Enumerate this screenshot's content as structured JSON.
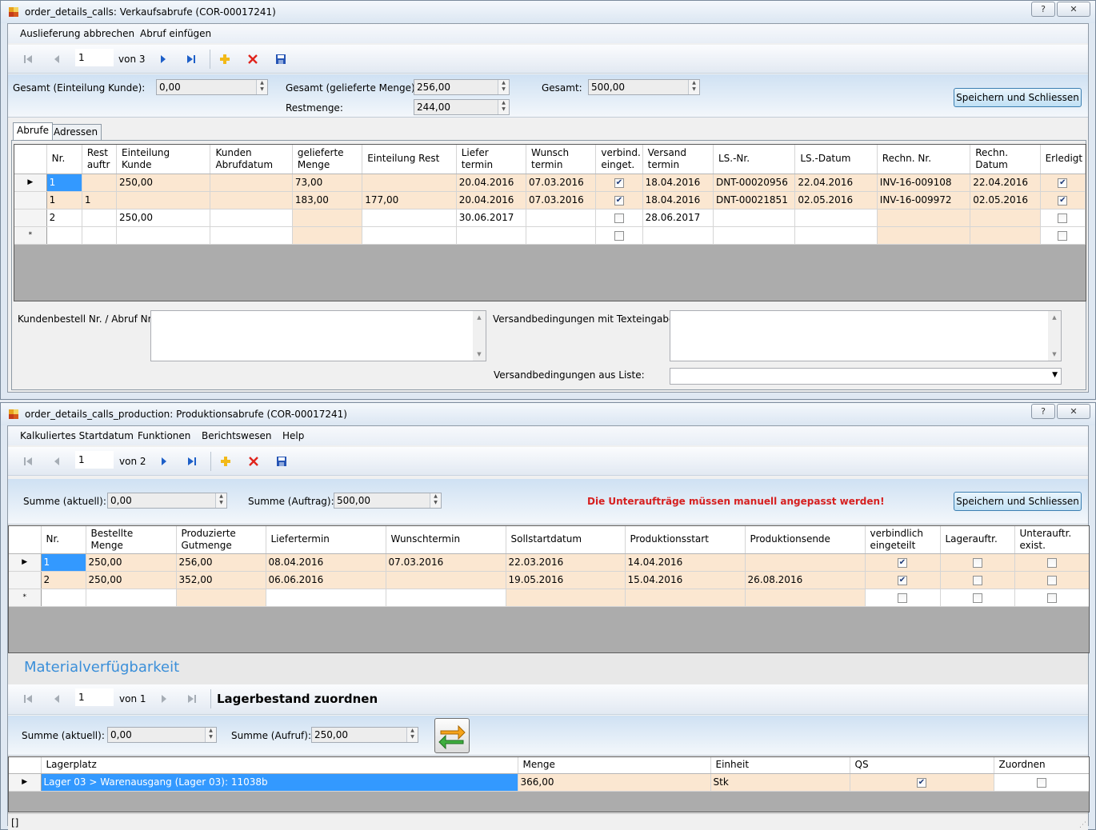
{
  "window1": {
    "title": "order_details_calls: Verkaufsabrufe (COR-00017241)",
    "help": "?",
    "close": "✕",
    "menu": [
      "Auslieferung abbrechen",
      "Abruf einfügen"
    ],
    "nav": {
      "position": "1",
      "of_label": "von 3"
    },
    "sums": {
      "gesamt_einteilung_label": "Gesamt (Einteilung Kunde):",
      "gesamt_einteilung_value": "0,00",
      "gesamt_geliefert_label": "Gesamt (gelieferte Menge):",
      "gesamt_geliefert_value": "256,00",
      "restmenge_label": "Restmenge:",
      "restmenge_value": "244,00",
      "gesamt_label": "Gesamt:",
      "gesamt_value": "500,00",
      "save_close": "Speichern und Schliessen"
    },
    "tabs": [
      "Abrufe",
      "Adressen"
    ],
    "grid_headers": [
      "Nr.",
      "Rest\nauftr",
      "Einteilung\nKunde",
      "Kunden\nAbrufdatum",
      "gelieferte\nMenge",
      "Einteilung Rest",
      "Liefer\ntermin",
      "Wunsch\ntermin",
      "verbind.\neinget.",
      "Versand\ntermin",
      "LS.-Nr.",
      "LS.-Datum",
      "Rechn. Nr.",
      "Rechn.\nDatum",
      "Erledigt"
    ],
    "grid_rows": [
      {
        "marker": "▶",
        "cells": [
          "1",
          "",
          "250,00",
          "",
          "73,00",
          "",
          "20.04.2016",
          "07.03.2016",
          true,
          "18.04.2016",
          "DNT-00020956",
          "22.04.2016",
          "INV-16-009108",
          "22.04.2016",
          true
        ]
      },
      {
        "marker": "",
        "cells": [
          "1",
          "1",
          "",
          "",
          "183,00",
          "177,00",
          "20.04.2016",
          "07.03.2016",
          true,
          "18.04.2016",
          "DNT-00021851",
          "02.05.2016",
          "INV-16-009972",
          "02.05.2016",
          true
        ]
      },
      {
        "marker": "",
        "cells": [
          "2",
          "",
          "250,00",
          "",
          "",
          "",
          "30.06.2017",
          "",
          false,
          "28.06.2017",
          "",
          "",
          "",
          "",
          false
        ]
      },
      {
        "marker": "*",
        "cells": [
          "",
          "",
          "",
          "",
          "",
          "",
          "",
          "",
          false,
          "",
          "",
          "",
          "",
          "",
          false
        ]
      }
    ],
    "kundenbestell_label": "Kundenbestell Nr. / Abruf Nr.:",
    "versand_text_label": "Versandbedingungen mit Texteingabe:",
    "versand_liste_label": "Versandbedingungen aus Liste:"
  },
  "window2": {
    "title": "order_details_calls_production: Produktionsabrufe (COR-00017241)",
    "help": "?",
    "close": "✕",
    "menu": [
      "Kalkuliertes Startdatum",
      "Funktionen",
      "Berichtswesen",
      "Help"
    ],
    "nav": {
      "position": "1",
      "of_label": "von 2"
    },
    "sums": {
      "summe_aktuell_label": "Summe (aktuell):",
      "summe_aktuell_value": "0,00",
      "summe_auftrag_label": "Summe (Auftrag):",
      "summe_auftrag_value": "500,00",
      "warning": "Die Unteraufträge müssen manuell angepasst werden!",
      "save_close": "Speichern und Schliessen"
    },
    "grid_headers": [
      "Nr.",
      "Bestellte\nMenge",
      "Produzierte\nGutmenge",
      "Liefertermin",
      "Wunschtermin",
      "Sollstartdatum",
      "Produktionsstart",
      "Produktionsende",
      "verbindlich\neingeteilt",
      "Lagerauftr.",
      "Unterauftr.\nexist."
    ],
    "grid_rows": [
      {
        "marker": "▶",
        "cells": [
          "1",
          "250,00",
          "256,00",
          "08.04.2016",
          "07.03.2016",
          "22.03.2016",
          "14.04.2016",
          "",
          true,
          false,
          false
        ]
      },
      {
        "marker": "",
        "cells": [
          "2",
          "250,00",
          "352,00",
          "06.06.2016",
          "",
          "19.05.2016",
          "15.04.2016",
          "26.08.2016",
          true,
          false,
          false
        ]
      },
      {
        "marker": "*",
        "cells": [
          "",
          "",
          "",
          "",
          "",
          "",
          "",
          "",
          false,
          false,
          false
        ]
      }
    ],
    "material_title": "Materialverfügbarkeit",
    "nav2": {
      "position": "1",
      "of_label": "von 1",
      "title": "Lagerbestand zuordnen"
    },
    "sums2": {
      "summe_aktuell_label": "Summe (aktuell):",
      "summe_aktuell_value": "0,00",
      "summe_aufruf_label": "Summe (Aufruf):",
      "summe_aufruf_value": "250,00"
    },
    "lager_headers": [
      "Lagerplatz",
      "Menge",
      "Einheit",
      "QS",
      "Zuordnen"
    ],
    "lager_rows": [
      {
        "marker": "▶",
        "cells": [
          "Lager 03 > Warenausgang (Lager 03): 11038b",
          "366,00",
          "Stk",
          true,
          false
        ]
      }
    ],
    "status_text": "[]"
  },
  "colors": {
    "accent": "#3399ff",
    "row_highlight": "#fbe7d1",
    "warning": "#d62020",
    "section_title": "#3b8fd9"
  }
}
